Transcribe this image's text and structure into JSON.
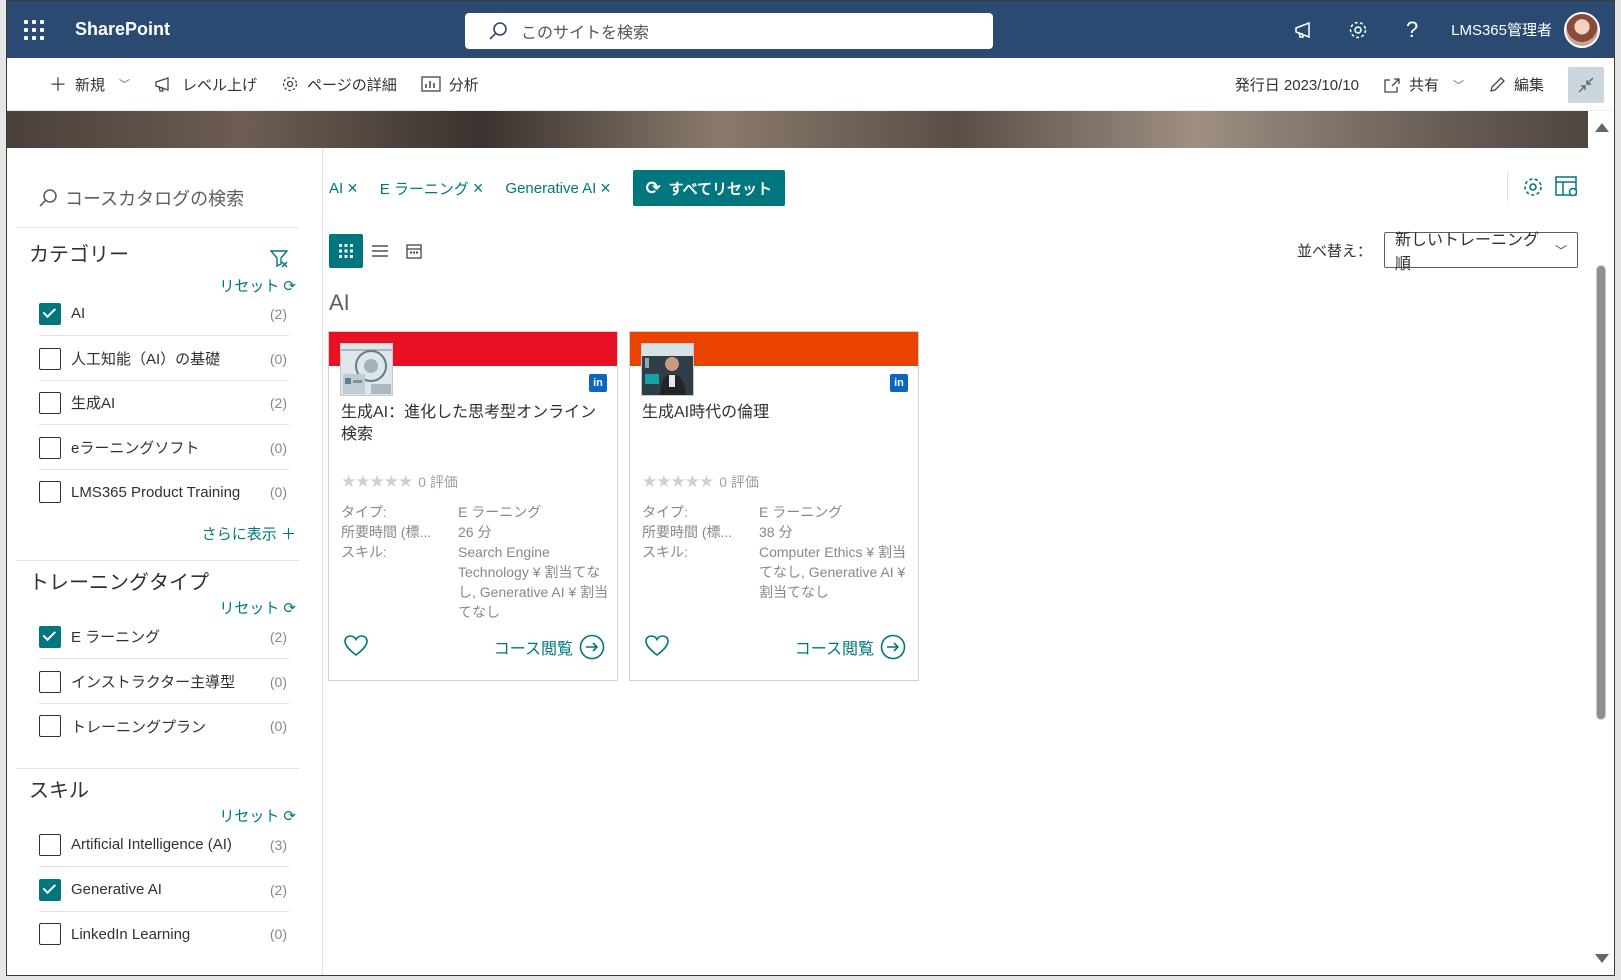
{
  "suite": {
    "app_name": "SharePoint",
    "search_placeholder": "このサイトを検索",
    "user_name": "LMS365管理者",
    "help_glyph": "?",
    "icons": [
      "waffle-icon",
      "megaphone-icon",
      "settings-icon",
      "help-icon"
    ]
  },
  "command_bar": {
    "new_label": "新規",
    "promote_label": "レベル上げ",
    "page_details_label": "ページの詳細",
    "analytics_label": "分析",
    "published_label": "発行日 2023/10/10",
    "share_label": "共有",
    "edit_label": "編集"
  },
  "sidebar": {
    "search_placeholder": "コースカタログの検索",
    "reset_label": "リセット",
    "show_more_label": "さらに表示",
    "facets": [
      {
        "title": "カテゴリー",
        "items": [
          {
            "label": "AI",
            "count": "(2)",
            "checked": true
          },
          {
            "label": "人工知能（AI）の基礎",
            "count": "(0)",
            "checked": false
          },
          {
            "label": "生成AI",
            "count": "(2)",
            "checked": false
          },
          {
            "label": "eラーニングソフト",
            "count": "(0)",
            "checked": false
          },
          {
            "label": "LMS365 Product Training",
            "count": "(0)",
            "checked": false
          }
        ]
      },
      {
        "title": "トレーニングタイプ",
        "items": [
          {
            "label": "E ラーニング",
            "count": "(2)",
            "checked": true
          },
          {
            "label": "インストラクター主導型",
            "count": "(0)",
            "checked": false
          },
          {
            "label": "トレーニングプラン",
            "count": "(0)",
            "checked": false
          }
        ]
      },
      {
        "title": "スキル",
        "items": [
          {
            "label": "Artificial Intelligence (AI)",
            "count": "(3)",
            "checked": false
          },
          {
            "label": "Generative AI",
            "count": "(2)",
            "checked": true
          },
          {
            "label": "LinkedIn Learning",
            "count": "(0)",
            "checked": false
          }
        ]
      }
    ]
  },
  "main": {
    "chips": [
      "AI",
      "E ラーニング",
      "Generative AI"
    ],
    "reset_all_label": "すべてリセット",
    "sort_label": "並べ替え：",
    "sort_value": "新しいトレーニング順",
    "section_title": "AI",
    "accent_color": "#00777e",
    "cards": [
      {
        "title": "生成AI：進化した思考型オンライン検索",
        "band_color": "#e81123",
        "rating_text": "0 評価",
        "meta": [
          {
            "key": "タイプ:",
            "value": "E ラーニング"
          },
          {
            "key": "所要時間 (標...",
            "value": "26 分"
          },
          {
            "key": "スキル:",
            "value": "Search Engine Technology ¥ 割当てなし, Generative AI ¥ 割当てなし"
          }
        ],
        "view_label": "コース閲覧"
      },
      {
        "title": "生成AI時代の倫理",
        "band_color": "#ea4300",
        "rating_text": "0 評価",
        "meta": [
          {
            "key": "タイプ:",
            "value": "E ラーニング"
          },
          {
            "key": "所要時間 (標...",
            "value": "38 分"
          },
          {
            "key": "スキル:",
            "value": "Computer Ethics ¥ 割当てなし, Generative AI ¥ 割当てなし"
          }
        ],
        "view_label": "コース閲覧"
      }
    ]
  }
}
